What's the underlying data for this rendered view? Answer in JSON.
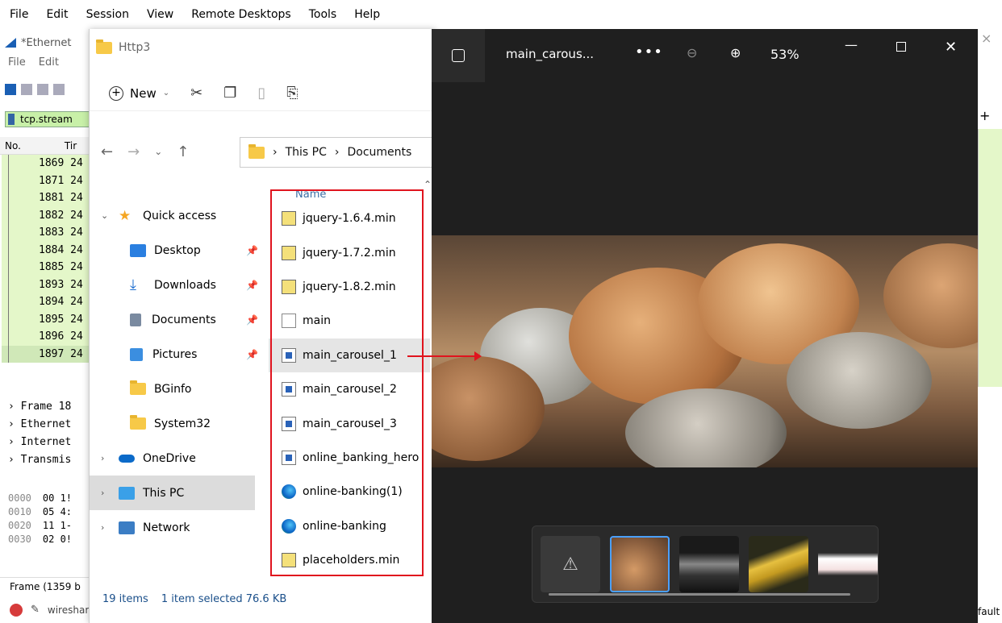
{
  "menu": [
    "File",
    "Edit",
    "Session",
    "View",
    "Remote Desktops",
    "Tools",
    "Help"
  ],
  "wireshark": {
    "title": "*Ethernet",
    "menu": [
      "File",
      "Edit"
    ],
    "filter": "tcp.stream",
    "col_no": "No.",
    "col_time": "Tir",
    "rows": [
      "1869 24",
      "1871 24",
      "1881 24",
      "1882 24",
      "1883 24",
      "1884 24",
      "1885 24",
      "1893 24",
      "1894 24",
      "1895 24",
      "1896 24",
      "1897 24"
    ],
    "tree": [
      "Frame 18",
      "Ethernet",
      "Internet",
      "Transmis"
    ],
    "hex": [
      [
        "0000",
        "00 1!"
      ],
      [
        "0010",
        "05 4:"
      ],
      [
        "0020",
        "11 1-"
      ],
      [
        "0030",
        "02 0!"
      ]
    ],
    "status": "Frame (1359 b",
    "bottom": "wireshark_Ethernet...",
    "right_label": "fault"
  },
  "explorer": {
    "title": "Http3",
    "new_label": "New",
    "path": [
      "This PC",
      "Documents"
    ],
    "name_header": "Name",
    "nav": [
      {
        "label": "Quick access",
        "icon": "star-icon",
        "top": true
      },
      {
        "label": "Desktop",
        "icon": "desktop-icon",
        "pin": true
      },
      {
        "label": "Downloads",
        "icon": "download-icon",
        "pin": true
      },
      {
        "label": "Documents",
        "icon": "documents-icon",
        "pin": true
      },
      {
        "label": "Pictures",
        "icon": "pictures-icon",
        "pin": true
      },
      {
        "label": "BGinfo",
        "icon": "folder-icon"
      },
      {
        "label": "System32",
        "icon": "folder-icon"
      },
      {
        "label": "OneDrive",
        "icon": "cloud-icon",
        "top": true
      },
      {
        "label": "This PC",
        "icon": "computer-icon",
        "top": true,
        "selected": true
      },
      {
        "label": "Network",
        "icon": "network-icon",
        "top": true
      }
    ],
    "files": [
      {
        "name": "jquery-1.6.4.min",
        "type": "js"
      },
      {
        "name": "jquery-1.7.2.min",
        "type": "js"
      },
      {
        "name": "jquery-1.8.2.min",
        "type": "js"
      },
      {
        "name": "main",
        "type": "cfg"
      },
      {
        "name": "main_carousel_1",
        "type": "img",
        "selected": true
      },
      {
        "name": "main_carousel_2",
        "type": "img"
      },
      {
        "name": "main_carousel_3",
        "type": "img"
      },
      {
        "name": "online_banking_hero",
        "type": "img"
      },
      {
        "name": "online-banking(1)",
        "type": "edge"
      },
      {
        "name": "online-banking",
        "type": "edge"
      },
      {
        "name": "placeholders.min",
        "type": "js"
      }
    ],
    "status_count": "19 items",
    "status_sel": "1 item selected  76.6 KB"
  },
  "photos": {
    "filename": "main_carous...",
    "zoom": "53%",
    "thumbnail_count": 5,
    "selected_thumbnail_index": 1
  }
}
